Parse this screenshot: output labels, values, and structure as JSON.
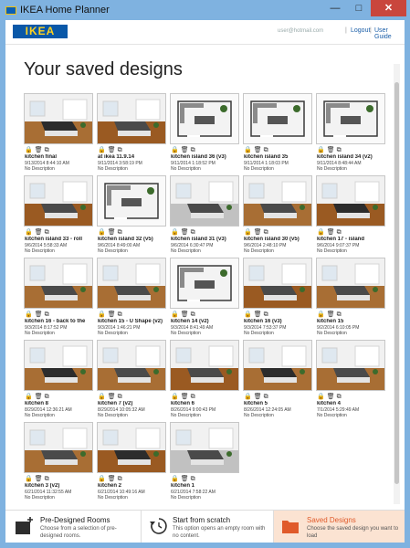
{
  "window": {
    "title": "IKEA Home Planner",
    "minimize_glyph": "—",
    "maximize_glyph": "□",
    "close_glyph": "✕"
  },
  "header": {
    "logo_text": "IKEA",
    "user_email": "user@hotmail.com",
    "logout_label": "Logout",
    "separator": "|",
    "guide_label": "User Guide"
  },
  "page": {
    "title": "Your saved designs"
  },
  "card_icon_names": [
    "lock-icon",
    "trash-icon",
    "copy-icon"
  ],
  "designs": [
    {
      "name": "kitchen final",
      "date": "9/13/2014 8:44:10 AM",
      "desc": "No Description",
      "view": "3d"
    },
    {
      "name": "at ikea 11.9.14",
      "date": "9/11/2014 3:58:19 PM",
      "desc": "No Description",
      "view": "3d"
    },
    {
      "name": "kitchen island 36 (v3)",
      "date": "9/11/2014 1:18:52 PM",
      "desc": "No Description",
      "view": "plan"
    },
    {
      "name": "kitchen island 35",
      "date": "9/11/2014 1:18:03 PM",
      "desc": "No Description",
      "view": "plan"
    },
    {
      "name": "kitchen island 34 (v2)",
      "date": "9/11/2014 8:48:44 AM",
      "desc": "No Description",
      "view": "plan"
    },
    {
      "name": "kitchen island 33 - roll",
      "date": "9/6/2014 5:58:33 AM",
      "desc": "No Description",
      "view": "3d"
    },
    {
      "name": "kitchen island 32 (v5)",
      "date": "9/6/2014 8:49:00 AM",
      "desc": "No Description",
      "view": "plan"
    },
    {
      "name": "kitchen island 31 (v3)",
      "date": "9/6/2014 6:30:47 PM",
      "desc": "No Description",
      "view": "3d"
    },
    {
      "name": "kitchen island 30 (v5)",
      "date": "9/6/2014 2:48:10 PM",
      "desc": "No Description",
      "view": "3d"
    },
    {
      "name": "kitchen 17 - island",
      "date": "9/6/2014 9:07:37 PM",
      "desc": "No Description",
      "view": "3d"
    },
    {
      "name": "kitchen 16 - back to the",
      "date": "9/3/2014 8:17:52 PM",
      "desc": "No Description",
      "view": "3d"
    },
    {
      "name": "kitchen 15 - U Shape (v2)",
      "date": "9/3/2014 1:46:21 PM",
      "desc": "No Description",
      "view": "3d"
    },
    {
      "name": "kitchen 14 (v2)",
      "date": "9/3/2014 8:41:49 AM",
      "desc": "No Description",
      "view": "plan"
    },
    {
      "name": "kitchen 16 (v3)",
      "date": "9/3/2014 7:53:37 PM",
      "desc": "No Description",
      "view": "3d"
    },
    {
      "name": "kitchen 15",
      "date": "9/2/2014 6:10:05 PM",
      "desc": "No Description",
      "view": "3d"
    },
    {
      "name": "kitchen 8",
      "date": "8/29/2014 12:36:21 AM",
      "desc": "No Description",
      "view": "3d"
    },
    {
      "name": "kitchen 7 (v2)",
      "date": "8/29/2014 10:05:32 AM",
      "desc": "No Description",
      "view": "3d"
    },
    {
      "name": "kitchen 6",
      "date": "8/26/2014 9:00:43 PM",
      "desc": "No Description",
      "view": "3d"
    },
    {
      "name": "kitchen 5",
      "date": "8/26/2014 12:24:05 AM",
      "desc": "No Description",
      "view": "3d"
    },
    {
      "name": "kitchen 4",
      "date": "7/1/2014 5:29:49 AM",
      "desc": "No Description",
      "view": "3d"
    },
    {
      "name": "kitchen 3 (v2)",
      "date": "6/21/2014 11:32:55 AM",
      "desc": "No Description",
      "view": "3d"
    },
    {
      "name": "kitchen 2",
      "date": "6/21/2014 10:49:16 AM",
      "desc": "No Description",
      "view": "3d"
    },
    {
      "name": "kitchen 1",
      "date": "6/21/2014 7:58:22 AM",
      "desc": "No Description",
      "view": "3d"
    }
  ],
  "footer": [
    {
      "title": "Pre-Designed Rooms",
      "desc": "Choose from a selection of pre-designed rooms.",
      "icon": "room-plus-icon",
      "selected": false
    },
    {
      "title": "Start from scratch",
      "desc": "This option opens an empty room with no content.",
      "icon": "refresh-icon",
      "selected": false
    },
    {
      "title": "Saved Designs",
      "desc": "Choose the saved design you want to load",
      "icon": "folder-icon",
      "selected": true
    }
  ],
  "colors": {
    "accent": "#e05a2a",
    "brand_blue": "#0a58a8",
    "brand_yellow": "#ffd21f",
    "link": "#1a5ea8"
  }
}
